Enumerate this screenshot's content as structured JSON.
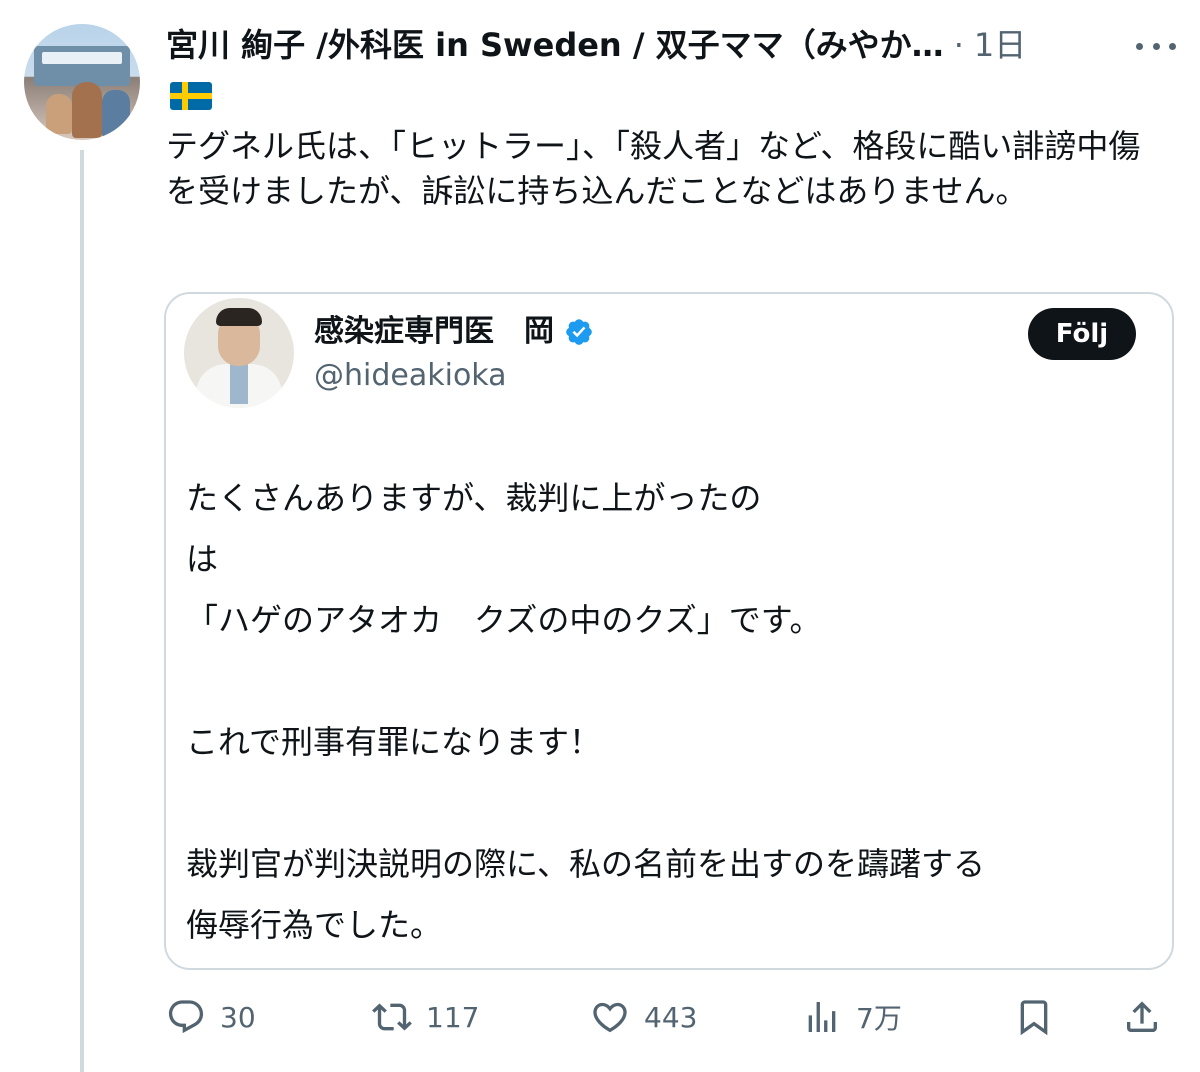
{
  "post": {
    "author_name": "宮川 絢子 /外科医 in Sweden / 双子ママ（みやか…",
    "separator": "·",
    "timestamp": "1日",
    "flag_icon": "sweden-flag-icon",
    "text": "テグネル氏は、「ヒットラー」、「殺人者」など、格段に酷い誹謗中傷を受けましたが、訴訟に持ち込んだことなどはありません。"
  },
  "quoted_post": {
    "author_name": "感染症専門医　岡",
    "handle": "@hideakioka",
    "verified": true,
    "follow_label": "Följ",
    "text": "たくさんありますが、裁判に上がったの\nは\n「ハゲのアタオカ　クズの中のクズ」です。\n\nこれで刑事有罪になります！\n\n裁判官が判決説明の際に、私の名前を出すのを躊躇する\n侮辱行為でした。"
  },
  "actions": {
    "replies": "30",
    "reposts": "117",
    "likes": "443",
    "views": "7万"
  },
  "colors": {
    "text_primary": "#0f1419",
    "text_secondary": "#536471",
    "border": "#cfd9de",
    "verified_blue": "#1d9bf0"
  }
}
